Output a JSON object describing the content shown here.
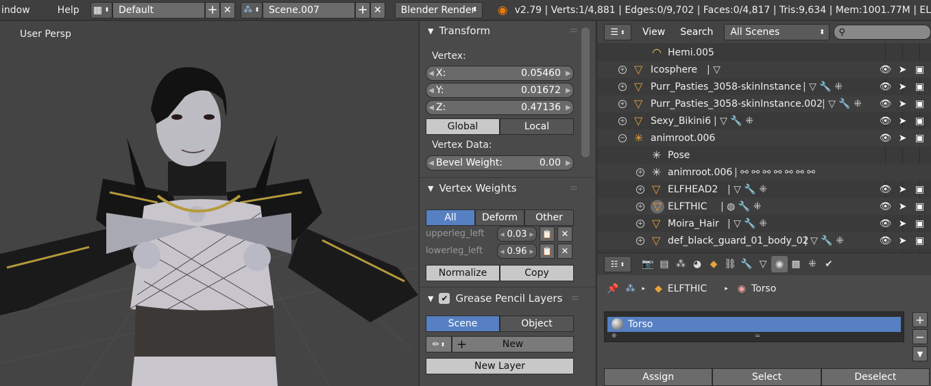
{
  "topbar": {
    "menu_window": "indow",
    "menu_help": "Help",
    "screen_layout": "Default",
    "scene_name": "Scene.007",
    "render_engine": "Blender Render",
    "stats": "v2.79 | Verts:1/4,881 | Edges:0/9,702 | Faces:0/4,817 | Tris:9,634 | Mem:1001.77M | EL"
  },
  "viewport": {
    "label": "User Persp"
  },
  "transform": {
    "title": "Transform",
    "vertex_label": "Vertex:",
    "x_label": "X:",
    "x_value": "0.05460",
    "y_label": "Y:",
    "y_value": "0.01672",
    "z_label": "Z:",
    "z_value": "0.47136",
    "global": "Global",
    "local": "Local",
    "vertex_data_label": "Vertex Data:",
    "bevel_label": "Bevel Weight:",
    "bevel_value": "0.00"
  },
  "vertex_weights": {
    "title": "Vertex Weights",
    "tab_all": "All",
    "tab_deform": "Deform",
    "tab_other": "Other",
    "groups": [
      {
        "name": "upperleg_left",
        "value": "0.03"
      },
      {
        "name": "lowerleg_left",
        "value": "0.96"
      }
    ],
    "normalize": "Normalize",
    "copy": "Copy"
  },
  "grease_pencil": {
    "title": "Grease Pencil Layers",
    "tab_scene": "Scene",
    "tab_object": "Object",
    "new": "New",
    "new_layer": "New Layer"
  },
  "outliner": {
    "view": "View",
    "search": "Search",
    "filter": "All Scenes",
    "rows": [
      {
        "name": "Hemi.005"
      },
      {
        "name": "Icosphere"
      },
      {
        "name": "Purr_Pasties_3058-skinInstance"
      },
      {
        "name": "Purr_Pasties_3058-skinInstance.002"
      },
      {
        "name": "Sexy_Bikini6"
      },
      {
        "name": "animroot.006"
      },
      {
        "name": "Pose"
      },
      {
        "name": "animroot.006"
      },
      {
        "name": "ELFHEAD2"
      },
      {
        "name": "ELFTHIC"
      },
      {
        "name": "Moira_Hair"
      },
      {
        "name": "def_black_guard_01_body_02"
      }
    ]
  },
  "material": {
    "object": "ELFTHIC",
    "material": "Torso",
    "slot_name": "Torso",
    "assign": "Assign",
    "select": "Select",
    "deselect": "Deselect"
  },
  "colors": {
    "accent_blue": "#5680c2",
    "mesh_orange": "#e8a33a",
    "panel_bg": "#4a4a4a",
    "viewport_bg": "#444444"
  }
}
